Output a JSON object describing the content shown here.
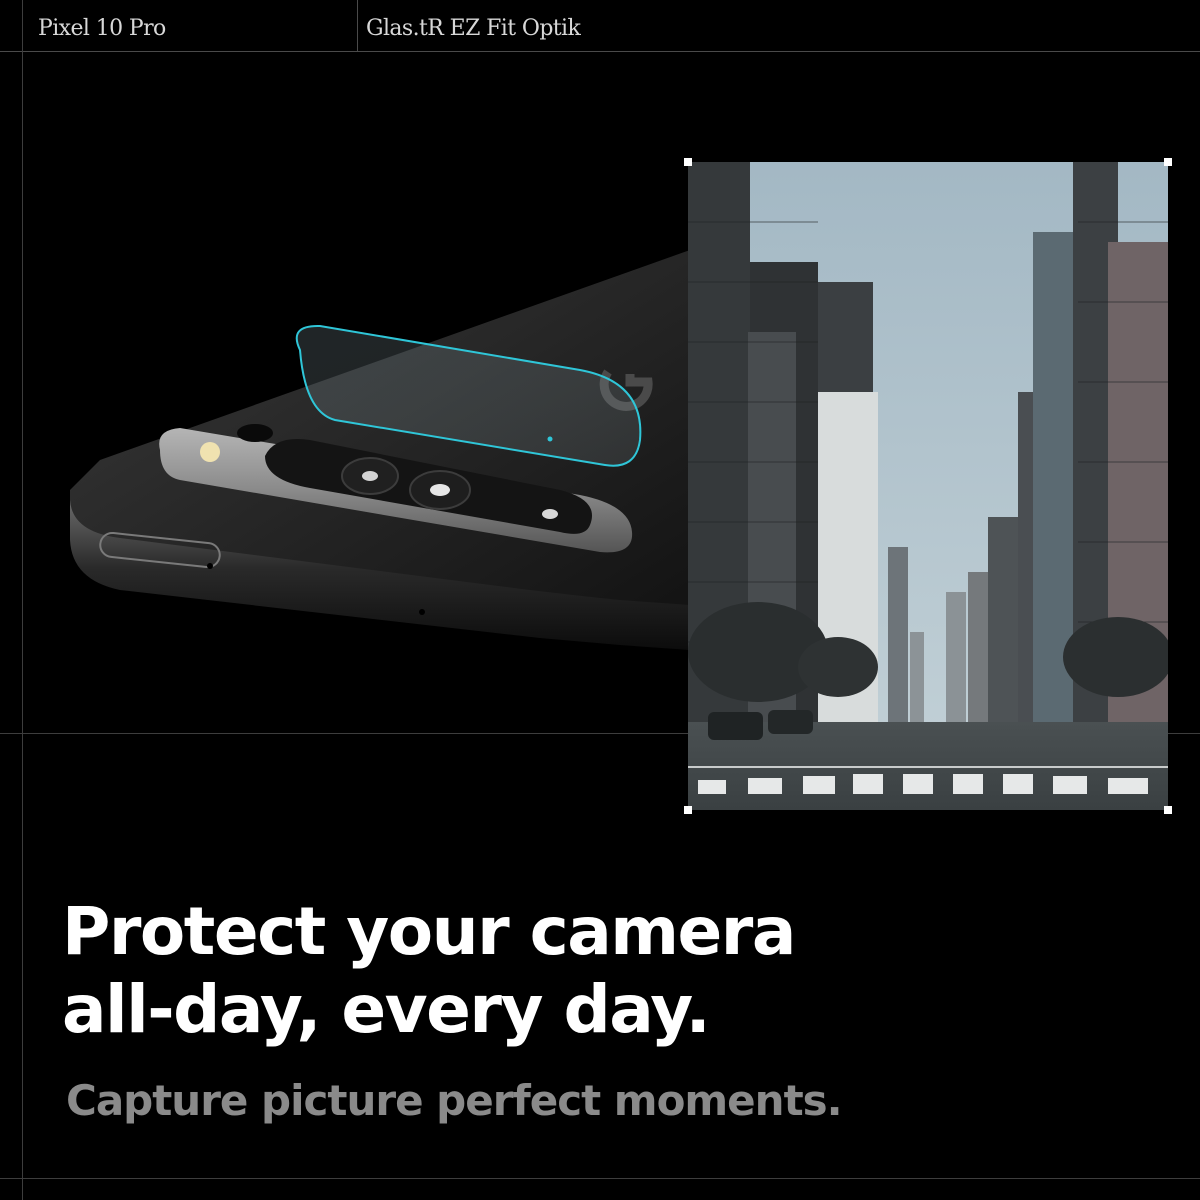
{
  "header": {
    "product": "Pixel 10 Pro",
    "model": "Glas.tR EZ Fit Optik"
  },
  "main": {
    "headline_line1": "Protect your camera",
    "headline_line2": "all-day, every day.",
    "subheadline": "Capture picture perfect moments."
  },
  "colors": {
    "background": "#000000",
    "headline": "#ffffff",
    "subheadline": "#8a8a8a",
    "lens_protector_edge": "#2fc6d8"
  },
  "icons": {
    "frame_handles": "crop-handle-icon",
    "brand_logo": "google-g-logo"
  }
}
